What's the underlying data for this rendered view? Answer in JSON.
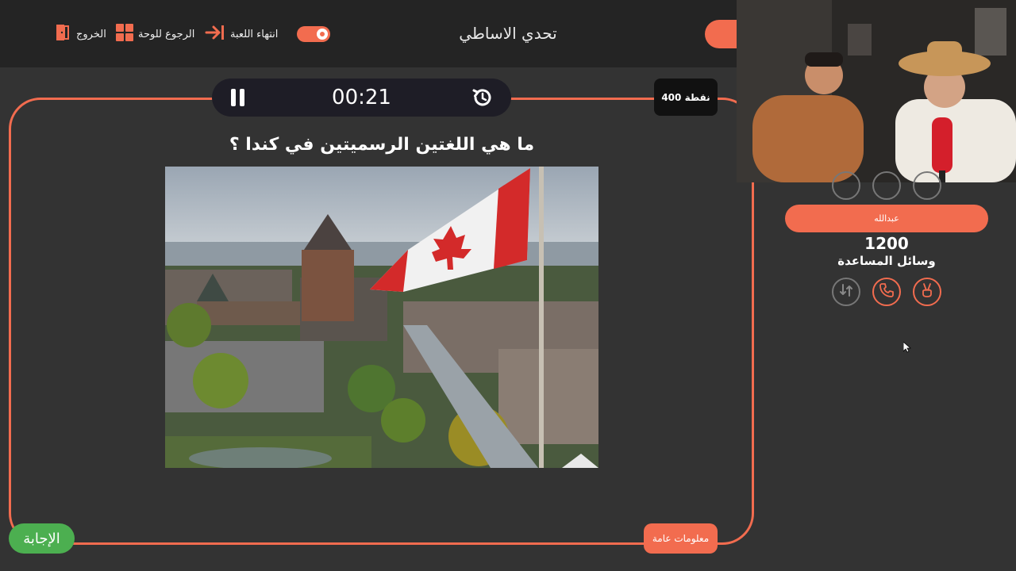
{
  "header": {
    "title": "تحدي الاساطي",
    "nav": {
      "exit_label": "الخروج",
      "back_to_board_label": "الرجوع للوحة",
      "end_game_label": "انتهاء اللعبة"
    }
  },
  "timer": {
    "value": "00:21"
  },
  "question": {
    "points_label": "400 نقطة",
    "text": "ما هي اللغتين الرسميتين في كندا ؟",
    "category_label": "معلومات عامة",
    "answer_button_label": "الإجابة"
  },
  "player": {
    "name": "عبدالله",
    "score": "1200",
    "helps_label": "وسائل المساعدة"
  },
  "colors": {
    "accent": "#f26c4f",
    "answer": "#4caf50",
    "background": "#333333",
    "topbar": "#242424"
  }
}
